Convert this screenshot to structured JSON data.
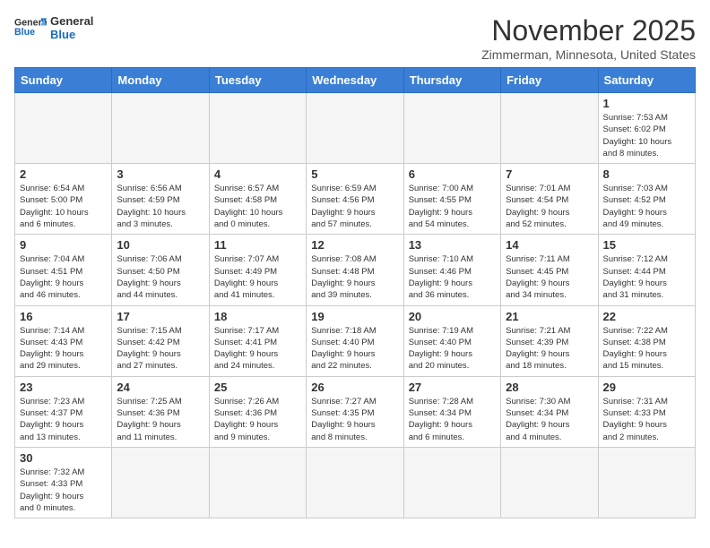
{
  "header": {
    "title": "November 2025",
    "subtitle": "Zimmerman, Minnesota, United States",
    "logo_line1": "General",
    "logo_line2": "Blue"
  },
  "weekdays": [
    "Sunday",
    "Monday",
    "Tuesday",
    "Wednesday",
    "Thursday",
    "Friday",
    "Saturday"
  ],
  "weeks": [
    [
      {
        "day": "",
        "info": ""
      },
      {
        "day": "",
        "info": ""
      },
      {
        "day": "",
        "info": ""
      },
      {
        "day": "",
        "info": ""
      },
      {
        "day": "",
        "info": ""
      },
      {
        "day": "",
        "info": ""
      },
      {
        "day": "1",
        "info": "Sunrise: 7:53 AM\nSunset: 6:02 PM\nDaylight: 10 hours\nand 8 minutes."
      }
    ],
    [
      {
        "day": "2",
        "info": "Sunrise: 6:54 AM\nSunset: 5:00 PM\nDaylight: 10 hours\nand 6 minutes."
      },
      {
        "day": "3",
        "info": "Sunrise: 6:56 AM\nSunset: 4:59 PM\nDaylight: 10 hours\nand 3 minutes."
      },
      {
        "day": "4",
        "info": "Sunrise: 6:57 AM\nSunset: 4:58 PM\nDaylight: 10 hours\nand 0 minutes."
      },
      {
        "day": "5",
        "info": "Sunrise: 6:59 AM\nSunset: 4:56 PM\nDaylight: 9 hours\nand 57 minutes."
      },
      {
        "day": "6",
        "info": "Sunrise: 7:00 AM\nSunset: 4:55 PM\nDaylight: 9 hours\nand 54 minutes."
      },
      {
        "day": "7",
        "info": "Sunrise: 7:01 AM\nSunset: 4:54 PM\nDaylight: 9 hours\nand 52 minutes."
      },
      {
        "day": "8",
        "info": "Sunrise: 7:03 AM\nSunset: 4:52 PM\nDaylight: 9 hours\nand 49 minutes."
      }
    ],
    [
      {
        "day": "9",
        "info": "Sunrise: 7:04 AM\nSunset: 4:51 PM\nDaylight: 9 hours\nand 46 minutes."
      },
      {
        "day": "10",
        "info": "Sunrise: 7:06 AM\nSunset: 4:50 PM\nDaylight: 9 hours\nand 44 minutes."
      },
      {
        "day": "11",
        "info": "Sunrise: 7:07 AM\nSunset: 4:49 PM\nDaylight: 9 hours\nand 41 minutes."
      },
      {
        "day": "12",
        "info": "Sunrise: 7:08 AM\nSunset: 4:48 PM\nDaylight: 9 hours\nand 39 minutes."
      },
      {
        "day": "13",
        "info": "Sunrise: 7:10 AM\nSunset: 4:46 PM\nDaylight: 9 hours\nand 36 minutes."
      },
      {
        "day": "14",
        "info": "Sunrise: 7:11 AM\nSunset: 4:45 PM\nDaylight: 9 hours\nand 34 minutes."
      },
      {
        "day": "15",
        "info": "Sunrise: 7:12 AM\nSunset: 4:44 PM\nDaylight: 9 hours\nand 31 minutes."
      }
    ],
    [
      {
        "day": "16",
        "info": "Sunrise: 7:14 AM\nSunset: 4:43 PM\nDaylight: 9 hours\nand 29 minutes."
      },
      {
        "day": "17",
        "info": "Sunrise: 7:15 AM\nSunset: 4:42 PM\nDaylight: 9 hours\nand 27 minutes."
      },
      {
        "day": "18",
        "info": "Sunrise: 7:17 AM\nSunset: 4:41 PM\nDaylight: 9 hours\nand 24 minutes."
      },
      {
        "day": "19",
        "info": "Sunrise: 7:18 AM\nSunset: 4:40 PM\nDaylight: 9 hours\nand 22 minutes."
      },
      {
        "day": "20",
        "info": "Sunrise: 7:19 AM\nSunset: 4:40 PM\nDaylight: 9 hours\nand 20 minutes."
      },
      {
        "day": "21",
        "info": "Sunrise: 7:21 AM\nSunset: 4:39 PM\nDaylight: 9 hours\nand 18 minutes."
      },
      {
        "day": "22",
        "info": "Sunrise: 7:22 AM\nSunset: 4:38 PM\nDaylight: 9 hours\nand 15 minutes."
      }
    ],
    [
      {
        "day": "23",
        "info": "Sunrise: 7:23 AM\nSunset: 4:37 PM\nDaylight: 9 hours\nand 13 minutes."
      },
      {
        "day": "24",
        "info": "Sunrise: 7:25 AM\nSunset: 4:36 PM\nDaylight: 9 hours\nand 11 minutes."
      },
      {
        "day": "25",
        "info": "Sunrise: 7:26 AM\nSunset: 4:36 PM\nDaylight: 9 hours\nand 9 minutes."
      },
      {
        "day": "26",
        "info": "Sunrise: 7:27 AM\nSunset: 4:35 PM\nDaylight: 9 hours\nand 8 minutes."
      },
      {
        "day": "27",
        "info": "Sunrise: 7:28 AM\nSunset: 4:34 PM\nDaylight: 9 hours\nand 6 minutes."
      },
      {
        "day": "28",
        "info": "Sunrise: 7:30 AM\nSunset: 4:34 PM\nDaylight: 9 hours\nand 4 minutes."
      },
      {
        "day": "29",
        "info": "Sunrise: 7:31 AM\nSunset: 4:33 PM\nDaylight: 9 hours\nand 2 minutes."
      }
    ],
    [
      {
        "day": "30",
        "info": "Sunrise: 7:32 AM\nSunset: 4:33 PM\nDaylight: 9 hours\nand 0 minutes."
      },
      {
        "day": "",
        "info": ""
      },
      {
        "day": "",
        "info": ""
      },
      {
        "day": "",
        "info": ""
      },
      {
        "day": "",
        "info": ""
      },
      {
        "day": "",
        "info": ""
      },
      {
        "day": "",
        "info": ""
      }
    ]
  ]
}
